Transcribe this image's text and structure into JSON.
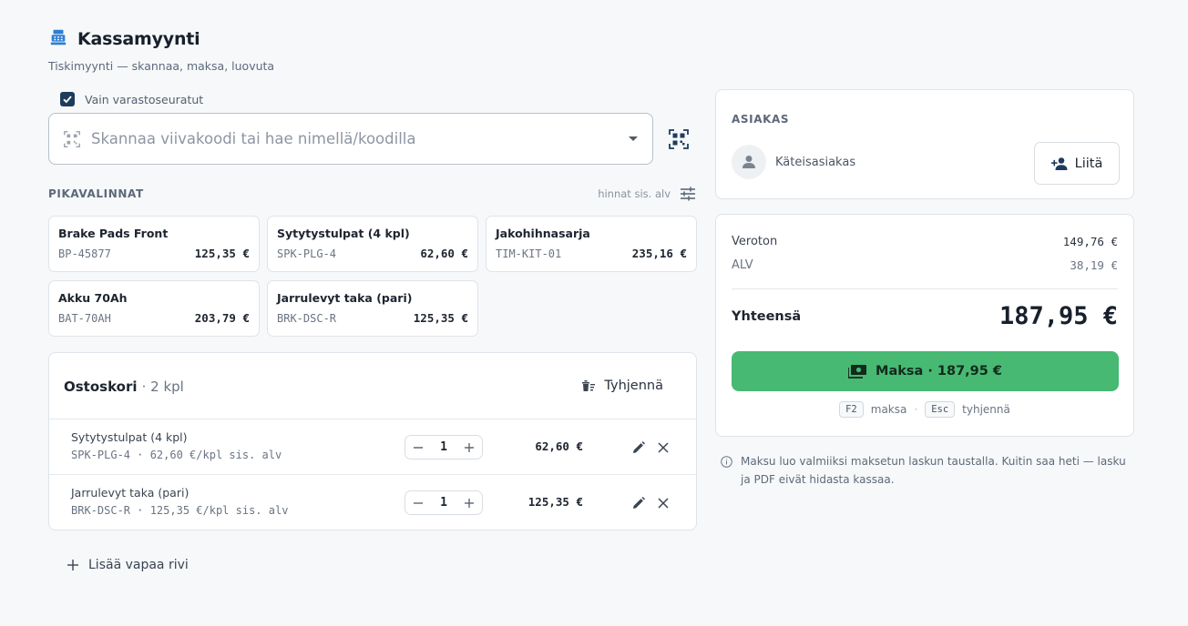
{
  "header": {
    "title": "Kassamyynti",
    "subtitle": "Tiskimyynti — skannaa, maksa, luovuta"
  },
  "filters": {
    "only_stock_tracked_label": "Vain varastoseuratut",
    "only_stock_tracked_checked": true
  },
  "search": {
    "placeholder": "Skannaa viivakoodi tai hae nimellä/koodilla",
    "value": ""
  },
  "quick_picks": {
    "title": "PIKAVALINNAT",
    "prices_note": "hinnat sis. alv",
    "items": [
      {
        "name": "Brake Pads Front",
        "code": "BP-45877",
        "price": "125,35 €"
      },
      {
        "name": "Sytytystulpat (4 kpl)",
        "code": "SPK-PLG-4",
        "price": "62,60 €"
      },
      {
        "name": "Jakohihnasarja",
        "code": "TIM-KIT-01",
        "price": "235,16 €"
      },
      {
        "name": "Akku 70Ah",
        "code": "BAT-70AH",
        "price": "203,79 €"
      },
      {
        "name": "Jarrulevyt taka (pari)",
        "code": "BRK-DSC-R",
        "price": "125,35 €"
      }
    ]
  },
  "cart": {
    "title": "Ostoskori",
    "count": "· 2 kpl",
    "clear_label": "Tyhjennä",
    "rows": [
      {
        "name": "Sytytystulpat (4 kpl)",
        "meta": "SPK-PLG-4 · 62,60 €/kpl sis. alv",
        "qty": "1",
        "total": "62,60 €"
      },
      {
        "name": "Jarrulevyt taka (pari)",
        "meta": "BRK-DSC-R · 125,35 €/kpl sis. alv",
        "qty": "1",
        "total": "125,35 €"
      }
    ],
    "add_free_row_label": "Lisää vapaa rivi"
  },
  "customer": {
    "label": "ASIAKAS",
    "name": "Käteisasiakas",
    "attach_label": "Liitä"
  },
  "totals": {
    "net_label": "Veroton",
    "net_value": "149,76 €",
    "vat_label": "ALV",
    "vat_value": "38,19 €",
    "grand_label": "Yhteensä",
    "grand_value": "187,95 €",
    "pay_label": "Maksa · 187,95 €",
    "shortcut_pay_key": "F2",
    "shortcut_pay_label": "maksa",
    "shortcut_separator": "·",
    "shortcut_clear_key": "Esc",
    "shortcut_clear_label": "tyhjennä"
  },
  "info_note": "Maksu luo valmiiksi maksetun laskun taustalla. Kuitin saa heti — lasku ja PDF eivät hidasta kassaa.",
  "colors": {
    "accent": "#1f3b5c",
    "pay_green": "#47b973",
    "icon_blue": "#2f7fd1"
  }
}
